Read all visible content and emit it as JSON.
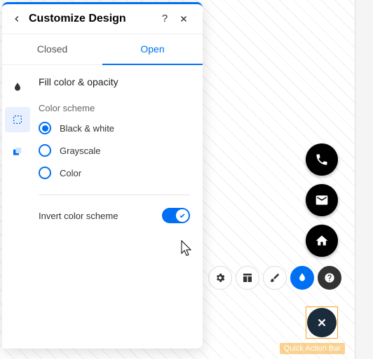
{
  "panel": {
    "title": "Customize Design",
    "tabs": {
      "closed": "Closed",
      "open": "Open"
    },
    "section_title": "Fill color & opacity",
    "color_scheme_label": "Color scheme",
    "options": {
      "bw": "Black & white",
      "grayscale": "Grayscale",
      "color": "Color"
    },
    "invert_label": "Invert color scheme"
  },
  "qab_label": "Quick Action Bar"
}
